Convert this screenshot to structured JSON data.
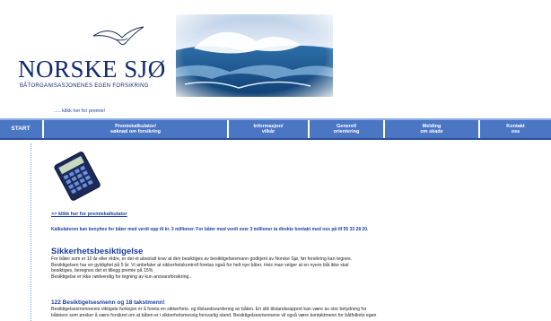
{
  "header": {
    "logo_name": "NORSKE SJØ",
    "logo_tagline": "BÅTORGANISASJONENES EGEN FORSIKRING",
    "hero_image": "ocean-waves-photo"
  },
  "premie_link": "..... klikk her for premie!",
  "nav": {
    "start": "START",
    "items": [
      {
        "line1": "Premiekalkulator/",
        "line2": "søknad om forsikring"
      },
      {
        "line1": "Informasjon/",
        "line2": "vilkår"
      },
      {
        "line1": "Generell",
        "line2": "orientering"
      },
      {
        "line1": "Melding",
        "line2": "om skade"
      },
      {
        "line1": "Kontakt",
        "line2": "oss"
      }
    ]
  },
  "content": {
    "calculator_icon": "calculator-icon",
    "calc_link": ">> klikk her for premiekalkulator",
    "calc_info": "Kalkulatoren kan benyttes for båter med verdi opp til kr. 3 millioner. For båter med verdi over 3 millioner ta direkte kontakt med oss på tlf 55 33 28 20.",
    "sik_title": "Sikkerhetsbesiktigelse",
    "sik_lines": [
      "For båter som er 10 år eller eldre, er det et absolutt krav at den besiktiges av besiktigelsesmann godkjent av Norske Sjø, før forsikring kan tegnes.",
      "Besiktigelsen har en gyldighet på 5 år.  Vi anbefaler at sikkerhetskontroll foretas også for helt nye båter. Hvis man velger at en nyere båt ikke skal",
      "besiktiges, beregnes det et tillegg premie på 15%",
      "Besiktigelse er ikke nødvendig for tegning av kun ansvarsforsikring.."
    ],
    "bes_title": "122 Besiktigelsesmenn og 18 takstmenn!",
    "bes_lines": [
      "Besiktigelsesmennenes viktigste funksjon er å foreta en sikkerhets- og tilstandsvurdering av båten. En slik tilstandsrapport kan være av stor betydning for",
      "båteiere som ønsker å være forsikret om at båten er i sikkerhetsmessig forsvarlig stand. Besiktigelsesmennene vil også være kontaktmenn for båtfolkets egen"
    ]
  },
  "colors": {
    "nav_bg": "#4a76c4",
    "brand_blue": "#1a3f9e",
    "logo_navy": "#0f2a6e"
  }
}
